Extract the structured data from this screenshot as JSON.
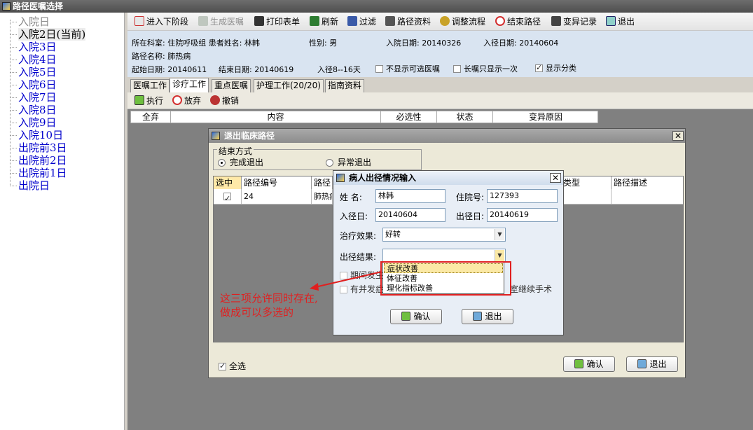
{
  "window": {
    "title": "路径医嘱选择"
  },
  "tree": [
    {
      "label": "入院日",
      "state": "grey"
    },
    {
      "label": "入院2日(当前)",
      "state": "sel"
    },
    {
      "label": "入院3日",
      "state": "blue"
    },
    {
      "label": "入院4日",
      "state": "blue"
    },
    {
      "label": "入院5日",
      "state": "blue"
    },
    {
      "label": "入院6日",
      "state": "blue"
    },
    {
      "label": "入院7日",
      "state": "blue"
    },
    {
      "label": "入院8日",
      "state": "blue"
    },
    {
      "label": "入院9日",
      "state": "blue"
    },
    {
      "label": "入院10日",
      "state": "blue"
    },
    {
      "label": "出院前3日",
      "state": "blue"
    },
    {
      "label": "出院前2日",
      "state": "blue"
    },
    {
      "label": "出院前1日",
      "state": "blue"
    },
    {
      "label": "出院日",
      "state": "blue"
    }
  ],
  "toolbar": {
    "next_stage": "进入下阶段",
    "gen_orders": "生成医嘱",
    "print": "打印表单",
    "refresh": "刷新",
    "filter": "过滤",
    "path_info": "路径资料",
    "adjust": "调整流程",
    "end_path": "结束路径",
    "variation": "变异记录",
    "exit": "退出"
  },
  "patient": {
    "dept": "所在科室: 住院呼吸组 患者姓名: 林韩",
    "sex": "性别:  男",
    "admit_date": "入院日期: 20140326",
    "path_date": "入径日期: 20140604",
    "path_name": "路径名称: 肺热病",
    "start": "起始日期: 20140611",
    "end": "结束日期: 20140619",
    "path_range": "入径8--16天",
    "opt1": "不显示可选医嘱",
    "opt2": "长嘱只显示一次",
    "opt3": "显示分类"
  },
  "tabs": [
    "医嘱工作",
    "诊疗工作",
    "重点医嘱",
    "护理工作(20/20)",
    "指南资料"
  ],
  "subtoolbar": {
    "execute": "执行",
    "abandon": "放弃",
    "undo": "撤销"
  },
  "grid_headers": [
    "全弃",
    "内容",
    "必选性",
    "状态",
    "变异原因"
  ],
  "exit_dialog": {
    "title": "退出临床路径",
    "group_label": "结束方式",
    "radio_complete": "完成退出",
    "radio_abnormal": "异常退出",
    "headers": [
      "选中",
      "路径编号",
      "路径",
      "类型",
      "路径描述"
    ],
    "row": {
      "id": "24",
      "name": "肺热病"
    },
    "select_all": "全选",
    "ok": "确认",
    "cancel": "退出"
  },
  "discharge_dialog": {
    "title": "病人出径情况输入",
    "name_label": "姓  名:",
    "name": "林韩",
    "inpatient_label": "住院号:",
    "inpatient_no": "127393",
    "enter_label": "入径日:",
    "enter_date": "20140604",
    "exit_label": "出径日:",
    "exit_date": "20140619",
    "effect_label": "治疗效果:",
    "effect_value": "好转",
    "result_label": "出径结果:",
    "result_value": "",
    "chk1": "期间发生",
    "chk2": "有并发症",
    "chk3": "室继续手术",
    "ok": "确认",
    "cancel": "退出"
  },
  "dropdown_options": [
    "症状改善",
    "体征改善",
    "理化指标改善"
  ],
  "annotation": {
    "line1": "这三项允许同时存在,",
    "line2": "做成可以多选的"
  }
}
